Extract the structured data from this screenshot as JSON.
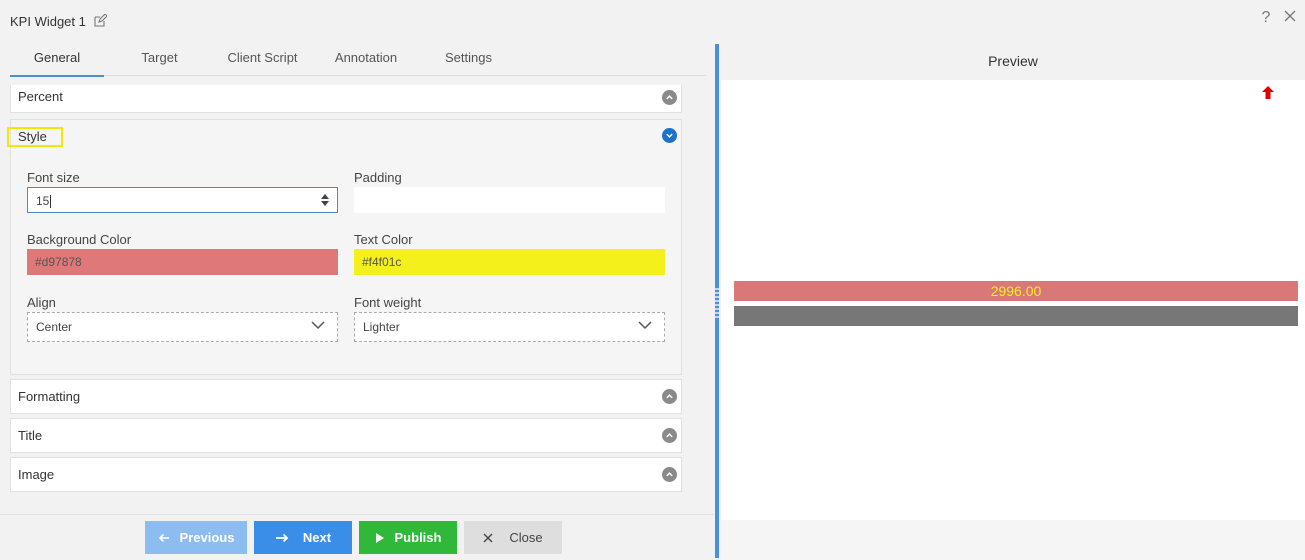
{
  "window": {
    "title": "KPI Widget 1",
    "help_icon": "question-icon",
    "close_icon": "close-icon"
  },
  "tabs": [
    {
      "label": "General",
      "active": true
    },
    {
      "label": "Target",
      "active": false
    },
    {
      "label": "Client Script",
      "active": false
    },
    {
      "label": "Annotation",
      "active": false
    },
    {
      "label": "Settings",
      "active": false
    }
  ],
  "sections": {
    "percent": {
      "label": "Percent",
      "expanded": false
    },
    "style": {
      "label": "Style",
      "expanded": true,
      "font_size": {
        "label": "Font size",
        "value": "15"
      },
      "padding": {
        "label": "Padding",
        "value": ""
      },
      "background_color": {
        "label": "Background Color",
        "value": "#d97878"
      },
      "text_color": {
        "label": "Text Color",
        "value": "#f4f01c"
      },
      "align": {
        "label": "Align",
        "value": "Center"
      },
      "font_weight": {
        "label": "Font weight",
        "value": "Lighter"
      }
    },
    "formatting": {
      "label": "Formatting",
      "expanded": false
    },
    "title": {
      "label": "Title",
      "expanded": false
    },
    "image": {
      "label": "Image",
      "expanded": false
    }
  },
  "buttons": {
    "previous": "Previous",
    "next": "Next",
    "publish": "Publish",
    "close": "Close"
  },
  "preview": {
    "header": "Preview",
    "kpi_value": "2996.00",
    "trend_icon": "arrow-up-icon"
  },
  "colors": {
    "accent": "#4a90e2",
    "next": "#3b8ee8",
    "publish": "#2fb83a",
    "kpi_bg": "#d97878",
    "kpi_text": "#f4f01c"
  }
}
